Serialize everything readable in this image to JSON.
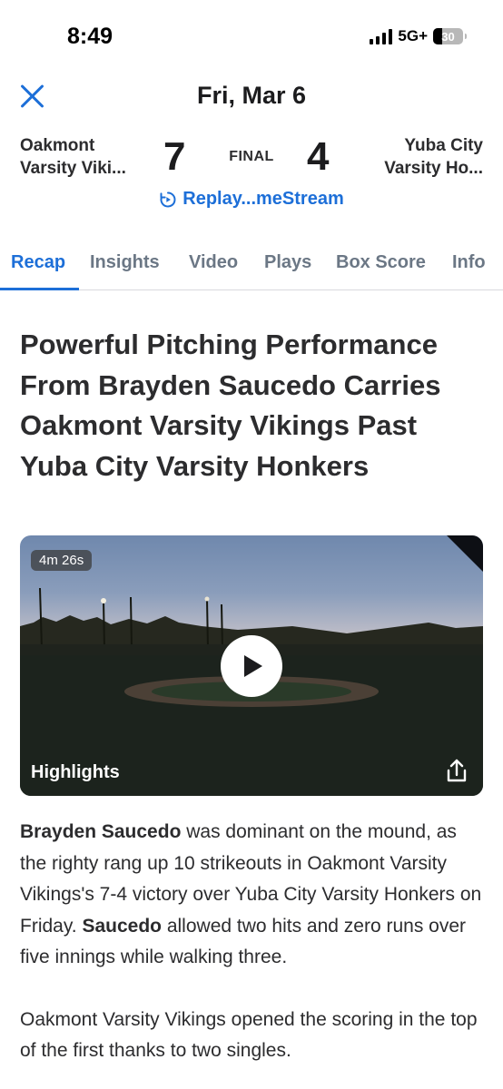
{
  "status_bar": {
    "time": "8:49",
    "network": "5G+",
    "battery": "30",
    "battery_level_pct": 30
  },
  "header": {
    "title": "Fri, Mar 6",
    "close_icon": "close-icon"
  },
  "game": {
    "home_team_line1": "Oakmont",
    "home_team_line2": "Varsity Viki...",
    "home_score": "7",
    "status": "FINAL",
    "away_score": "4",
    "away_team_line1": "Yuba City",
    "away_team_line2": "Varsity Ho...",
    "replay_label": "Replay...meStream"
  },
  "tabs": [
    {
      "label": "Recap",
      "active": true
    },
    {
      "label": "Insights",
      "active": false
    },
    {
      "label": "Video",
      "active": false
    },
    {
      "label": "Plays",
      "active": false
    },
    {
      "label": "Box Score",
      "active": false
    },
    {
      "label": "Info",
      "active": false
    }
  ],
  "article": {
    "headline": "Powerful Pitching Performance From Brayden Saucedo Carries Oakmont Varsity Vikings Past Yuba City Varsity Honkers",
    "video": {
      "duration": "4m 26s",
      "label": "Highlights"
    },
    "paragraph1": {
      "bold1": "Brayden Saucedo",
      "text1": " was dominant on the mound, as the righty rang up 10 strikeouts in Oakmont Varsity Vikings's 7-4 victory over Yuba City Varsity Honkers on Friday. ",
      "bold2": "Saucedo",
      "text2": " allowed two hits and zero runs over five innings while walking three."
    },
    "paragraph2": "Oakmont Varsity Vikings opened the scoring in the top of the first thanks to two singles."
  },
  "colors": {
    "accent": "#1d6fd8",
    "tab_inactive": "#6b7785",
    "text": "#2c2c2e"
  }
}
